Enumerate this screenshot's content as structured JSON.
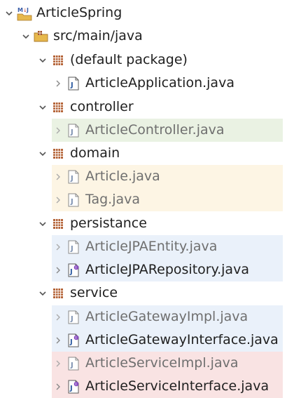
{
  "tree": {
    "project": {
      "label": "ArticleSpring",
      "icon": "maven-project-icon"
    },
    "source_folder": {
      "label": "src/main/java",
      "icon": "source-folder-icon"
    },
    "packages": [
      {
        "label": "(default package)",
        "files": [
          {
            "label": "ArticleApplication.java",
            "kind": "class"
          }
        ]
      },
      {
        "label": "controller",
        "files": [
          {
            "label": "ArticleController.java",
            "kind": "class"
          }
        ]
      },
      {
        "label": "domain",
        "files": [
          {
            "label": "Article.java",
            "kind": "class"
          },
          {
            "label": "Tag.java",
            "kind": "class"
          }
        ]
      },
      {
        "label": "persistance",
        "files": [
          {
            "label": "ArticleJPAEntity.java",
            "kind": "class"
          },
          {
            "label": "ArticleJPARepository.java",
            "kind": "interface"
          }
        ]
      },
      {
        "label": "service",
        "files": [
          {
            "label": "ArticleGatewayImpl.java",
            "kind": "class"
          },
          {
            "label": "ArticleGatewayInterface.java",
            "kind": "interface"
          },
          {
            "label": "ArticleServiceImpl.java",
            "kind": "class"
          },
          {
            "label": "ArticleServiceInterface.java",
            "kind": "interface"
          }
        ]
      }
    ]
  },
  "colors": {
    "highlight_green": "#eaf2e3",
    "highlight_yellow": "#fdf5e4",
    "highlight_blue": "#eaf1fa",
    "highlight_red": "#f9e3e3",
    "package_icon": "#a0522d",
    "folder_icon": "#d9a441"
  }
}
